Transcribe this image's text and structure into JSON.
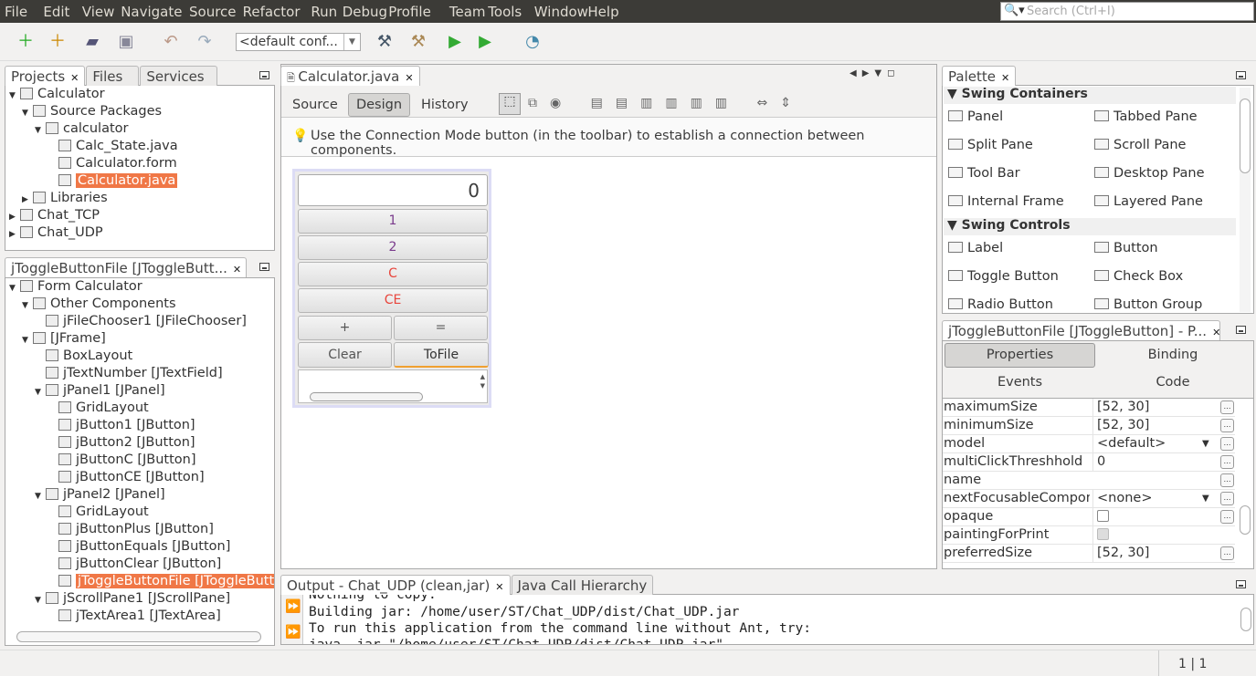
{
  "menu": [
    "File",
    "Edit",
    "View",
    "Navigate",
    "Source",
    "Refactor",
    "Run",
    "Debug",
    "Profile",
    "Team",
    "Tools",
    "Window",
    "Help"
  ],
  "search": {
    "placeholder": "Search (Ctrl+I)"
  },
  "toolbar": {
    "config": "<default conf...",
    "icons": [
      "new-file",
      "new-project",
      "open-project",
      "save-all",
      "undo",
      "redo",
      "build",
      "clean-build",
      "run",
      "debug",
      "profile"
    ]
  },
  "projects": {
    "tabs": [
      "Projects",
      "Files",
      "Services"
    ],
    "tree": [
      {
        "label": "Calculator",
        "level": 0,
        "tw": "▼",
        "icon": "java-project-icon"
      },
      {
        "label": "Source Packages",
        "level": 1,
        "tw": "▼",
        "icon": "source-packages-icon"
      },
      {
        "label": "calculator",
        "level": 2,
        "tw": "▼",
        "icon": "package-icon"
      },
      {
        "label": "Calc_State.java",
        "level": 3,
        "tw": "",
        "icon": "java-file-icon"
      },
      {
        "label": "Calculator.form",
        "level": 3,
        "tw": "",
        "icon": "form-file-icon"
      },
      {
        "label": "Calculator.java",
        "level": 3,
        "tw": "",
        "icon": "java-form-icon",
        "selected": true
      },
      {
        "label": "Libraries",
        "level": 1,
        "tw": "▶",
        "icon": "libraries-icon"
      },
      {
        "label": "Chat_TCP",
        "level": 0,
        "tw": "▶",
        "icon": "java-project-icon"
      },
      {
        "label": "Chat_UDP",
        "level": 0,
        "tw": "▶",
        "icon": "java-project-icon"
      }
    ]
  },
  "navigator": {
    "title": "jToggleButtonFile [JToggleButt...",
    "tree": [
      {
        "label": "Form Calculator",
        "level": 0,
        "tw": "▼",
        "icon": "form-icon"
      },
      {
        "label": "Other Components",
        "level": 1,
        "tw": "▼",
        "icon": "other-components-icon"
      },
      {
        "label": "jFileChooser1 [JFileChooser]",
        "level": 2,
        "tw": "",
        "icon": "file-chooser-icon"
      },
      {
        "label": "[JFrame]",
        "level": 1,
        "tw": "▼",
        "icon": "frame-icon"
      },
      {
        "label": "BoxLayout",
        "level": 2,
        "tw": "",
        "icon": "layout-icon"
      },
      {
        "label": "jTextNumber [JTextField]",
        "level": 2,
        "tw": "",
        "icon": "textfield-icon"
      },
      {
        "label": "jPanel1 [JPanel]",
        "level": 2,
        "tw": "▼",
        "icon": "panel-icon"
      },
      {
        "label": "GridLayout",
        "level": 3,
        "tw": "",
        "icon": "layout-icon"
      },
      {
        "label": "jButton1 [JButton]",
        "level": 3,
        "tw": "",
        "icon": "button-icon"
      },
      {
        "label": "jButton2 [JButton]",
        "level": 3,
        "tw": "",
        "icon": "button-icon"
      },
      {
        "label": "jButtonC [JButton]",
        "level": 3,
        "tw": "",
        "icon": "button-icon"
      },
      {
        "label": "jButtonCE [JButton]",
        "level": 3,
        "tw": "",
        "icon": "button-icon"
      },
      {
        "label": "jPanel2 [JPanel]",
        "level": 2,
        "tw": "▼",
        "icon": "panel-icon"
      },
      {
        "label": "GridLayout",
        "level": 3,
        "tw": "",
        "icon": "layout-icon"
      },
      {
        "label": "jButtonPlus [JButton]",
        "level": 3,
        "tw": "",
        "icon": "button-icon"
      },
      {
        "label": "jButtonEquals [JButton]",
        "level": 3,
        "tw": "",
        "icon": "button-icon"
      },
      {
        "label": "jButtonClear [JButton]",
        "level": 3,
        "tw": "",
        "icon": "button-icon"
      },
      {
        "label": "jToggleButtonFile [JToggleButton]",
        "level": 3,
        "tw": "",
        "icon": "toggle-button-icon",
        "selected": true
      },
      {
        "label": "jScrollPane1 [JScrollPane]",
        "level": 2,
        "tw": "▼",
        "icon": "scrollpane-icon"
      },
      {
        "label": "jTextArea1 [JTextArea]",
        "level": 3,
        "tw": "",
        "icon": "textarea-icon"
      }
    ]
  },
  "editor": {
    "tab": "Calculator.java",
    "views": [
      "Source",
      "Design",
      "History"
    ],
    "active_view": "Design",
    "hint": "Use the Connection Mode button (in the toolbar) to establish a connection between components.",
    "form": {
      "display": "0",
      "buttons": [
        "1",
        "2",
        "C",
        "CE"
      ],
      "row_buttons": [
        [
          "+",
          "="
        ],
        [
          "Clear",
          "ToFile"
        ]
      ],
      "red_color": "#e8453c",
      "purple_color": "#7a3b8c"
    }
  },
  "palette": {
    "title": "Palette",
    "sections": [
      {
        "title": "Swing Containers",
        "items": [
          "Panel",
          "Tabbed Pane",
          "Split Pane",
          "Scroll Pane",
          "Tool Bar",
          "Desktop Pane",
          "Internal Frame",
          "Layered Pane"
        ]
      },
      {
        "title": "Swing Controls",
        "items": [
          "Label",
          "Button",
          "Toggle Button",
          "Check Box",
          "Radio Button",
          "Button Group"
        ]
      }
    ]
  },
  "properties": {
    "title": "jToggleButtonFile [JToggleButton] - P...",
    "tabs": [
      "Properties",
      "Binding",
      "Events",
      "Code"
    ],
    "rows": [
      {
        "name": "maximumSize",
        "value": "[52, 30]"
      },
      {
        "name": "minimumSize",
        "value": "[52, 30]"
      },
      {
        "name": "model",
        "value": "<default>",
        "dropdown": true
      },
      {
        "name": "multiClickThreshhold",
        "value": "0"
      },
      {
        "name": "name",
        "value": ""
      },
      {
        "name": "nextFocusableComponent",
        "value": "<none>",
        "dropdown": true
      },
      {
        "name": "opaque",
        "checkbox": true,
        "checked": false
      },
      {
        "name": "paintingForPrint",
        "checkbox": true,
        "disabled": true
      },
      {
        "name": "preferredSize",
        "value": "[52, 30]"
      }
    ]
  },
  "output": {
    "tabs": [
      "Output - Chat_UDP (clean,jar)",
      "Java Call Hierarchy"
    ],
    "lines": [
      "Nothing to copy.",
      "Building jar: /home/user/ST/Chat_UDP/dist/Chat_UDP.jar",
      "To run this application from the command line without Ant, try:",
      "java -jar \"/home/user/ST/Chat_UDP/dist/Chat_UDP.jar\""
    ]
  },
  "status": {
    "position": "1 | 1"
  }
}
